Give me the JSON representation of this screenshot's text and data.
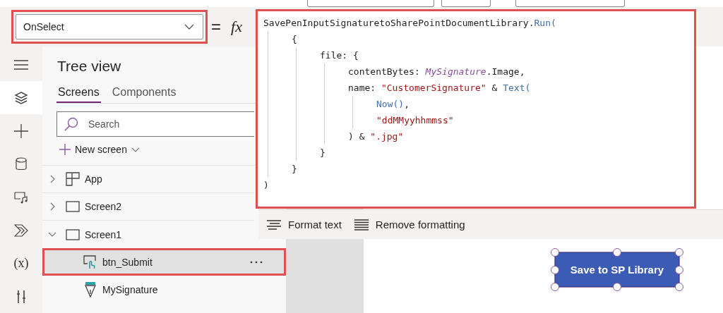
{
  "formula_bar": {
    "property": "OnSelect",
    "highlighted": true,
    "equals": "=",
    "fx": "fx"
  },
  "rail": [
    {
      "kind": "menu",
      "selected": false
    },
    {
      "kind": "layers",
      "selected": true
    },
    {
      "kind": "insert",
      "selected": false
    },
    {
      "kind": "data",
      "selected": false
    },
    {
      "kind": "media",
      "selected": false
    },
    {
      "kind": "automate",
      "selected": false
    },
    {
      "kind": "variables",
      "label": "(x)",
      "selected": false
    },
    {
      "kind": "tools",
      "selected": false
    }
  ],
  "tree_view": {
    "title": "Tree view",
    "tabs": [
      {
        "label": "Screens",
        "selected": true
      },
      {
        "label": "Components",
        "selected": false
      }
    ],
    "search": {
      "placeholder": "Search"
    },
    "new_screen": "New screen",
    "items": [
      {
        "label": "App",
        "kind": "app",
        "expanded": false,
        "selected": false,
        "highlighted": false
      },
      {
        "label": "Screen2",
        "kind": "screen",
        "expanded": false,
        "selected": false,
        "highlighted": false
      },
      {
        "label": "Screen1",
        "kind": "screen",
        "expanded": true,
        "selected": false,
        "highlighted": false,
        "children": [
          {
            "label": "btn_Submit",
            "kind": "button",
            "selected": true,
            "highlighted": true
          },
          {
            "label": "MySignature",
            "kind": "pen",
            "selected": false,
            "highlighted": false
          }
        ]
      }
    ]
  },
  "formula_editor": {
    "highlighted": true,
    "code": [
      {
        "tokens": [
          {
            "kind": "plain",
            "text": "SavePenInputSignaturetoSharePointDocumentLibrary."
          },
          {
            "kind": "func",
            "text": "Run("
          }
        ],
        "children": [
          {
            "tokens": [
              {
                "kind": "plain",
                "text": "{"
              }
            ],
            "children": [
              {
                "tokens": [
                  {
                    "kind": "plain",
                    "text": "file: {"
                  }
                ],
                "children": [
                  {
                    "tokens": [
                      {
                        "kind": "plain",
                        "text": "contentBytes: "
                      },
                      {
                        "kind": "ident",
                        "text": "MySignature"
                      },
                      {
                        "kind": "plain",
                        "text": ".Image,"
                      }
                    ]
                  },
                  {
                    "tokens": [
                      {
                        "kind": "plain",
                        "text": "name: "
                      },
                      {
                        "kind": "string",
                        "text": "\"CustomerSignature\""
                      },
                      {
                        "kind": "plain",
                        "text": " & "
                      },
                      {
                        "kind": "func",
                        "text": "Text("
                      }
                    ],
                    "children": [
                      {
                        "tokens": [
                          {
                            "kind": "func",
                            "text": "Now()"
                          },
                          {
                            "kind": "plain",
                            "text": ","
                          }
                        ]
                      },
                      {
                        "tokens": [
                          {
                            "kind": "string",
                            "text": "\"ddMMyyhhmmss\""
                          }
                        ]
                      }
                    ]
                  },
                  {
                    "tokens": [
                      {
                        "kind": "plain",
                        "text": ") & "
                      },
                      {
                        "kind": "string",
                        "text": "\".jpg\""
                      }
                    ]
                  }
                ]
              },
              {
                "tokens": [
                  {
                    "kind": "plain",
                    "text": "}"
                  }
                ]
              }
            ]
          },
          {
            "tokens": [
              {
                "kind": "plain",
                "text": "}"
              }
            ]
          }
        ]
      },
      {
        "tokens": [
          {
            "kind": "plain",
            "text": ")"
          }
        ]
      }
    ],
    "actions": [
      {
        "kind": "format",
        "label": "Format text"
      },
      {
        "kind": "remove",
        "label": "Remove formatting"
      }
    ]
  },
  "canvas": {
    "button": {
      "label": "Save to SP Library",
      "selected": true
    }
  }
}
